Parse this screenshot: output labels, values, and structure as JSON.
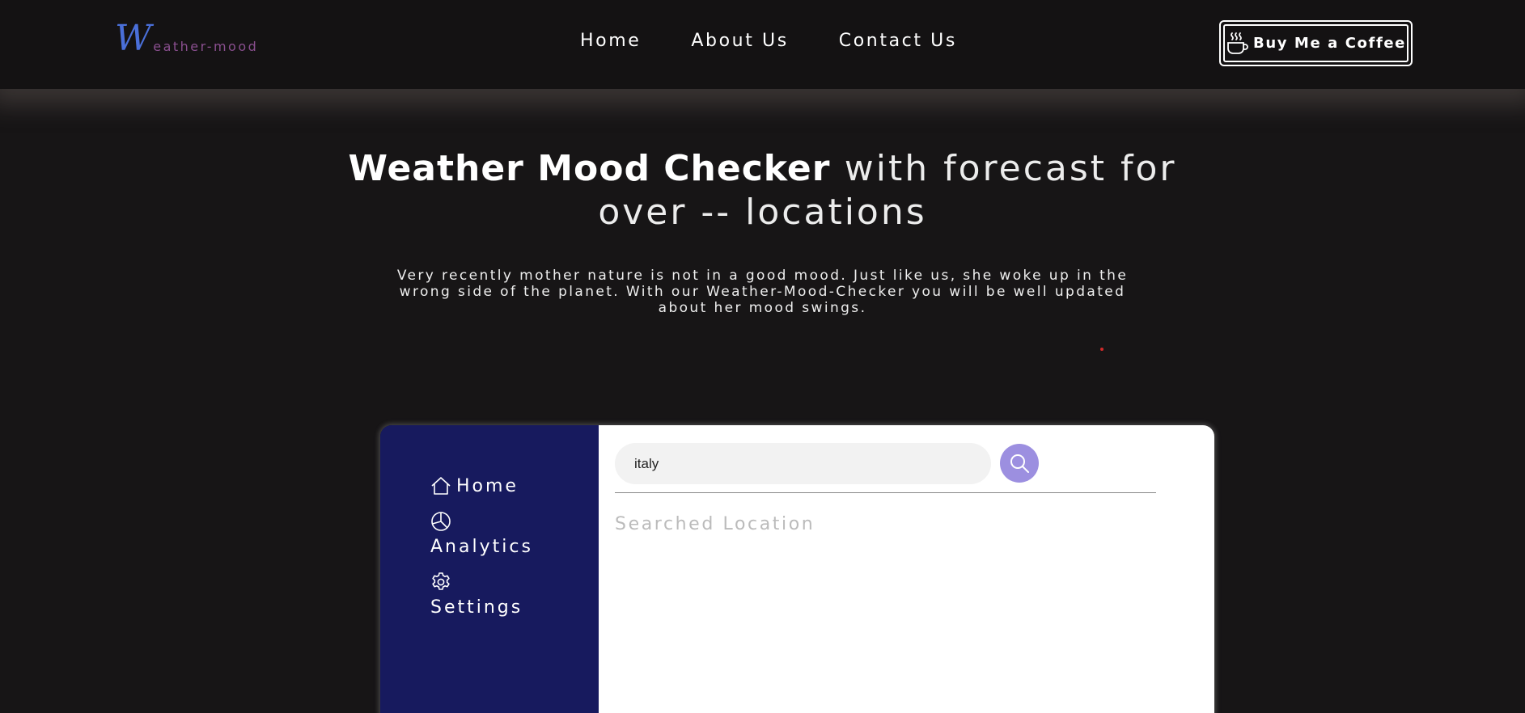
{
  "header": {
    "logo_initial": "W",
    "logo_rest": "eather-mood",
    "nav": [
      {
        "label": "Home"
      },
      {
        "label": "About Us"
      },
      {
        "label": "Contact Us"
      }
    ],
    "coffee_button": {
      "label": "Buy Me a Coffee",
      "icon": "coffee-cup-icon"
    }
  },
  "hero": {
    "title_bold": "Weather Mood Checker",
    "title_light": "with forecast for over -- locations",
    "subtitle": "Very recently mother nature is not in a good mood. Just like us, she woke up in the wrong side of the planet. With our Weather-Mood-Checker you will be well updated about her mood swings."
  },
  "sidebar": {
    "items": [
      {
        "label": "Home",
        "icon": "home-icon"
      },
      {
        "label": "Analytics",
        "icon": "pie-chart-icon"
      },
      {
        "label": "Settings",
        "icon": "gear-icon"
      }
    ]
  },
  "search": {
    "value": "italy",
    "button_icon": "search-icon"
  },
  "results": {
    "heading": "Searched Location"
  },
  "colors": {
    "background": "#171516",
    "header_bg": "#141213",
    "sidebar_bg": "#171a5e",
    "search_button": "#9c8fe0",
    "logo_initial": "#4a6fd9",
    "logo_text": "#8a4f8f"
  }
}
